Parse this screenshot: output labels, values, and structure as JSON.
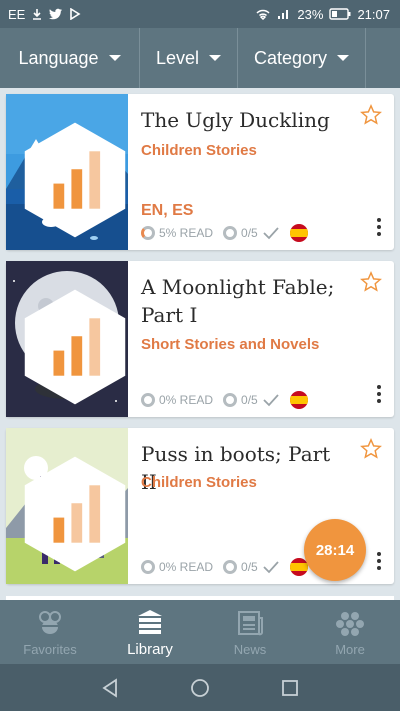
{
  "status_bar": {
    "carrier": "EE",
    "battery": "23%",
    "time": "21:07"
  },
  "filters": [
    {
      "label": "Language"
    },
    {
      "label": "Level"
    },
    {
      "label": "Category"
    }
  ],
  "books": [
    {
      "title": "The Ugly Duckling",
      "category": "Children Stories",
      "languages": "EN, ES",
      "read": "5% READ",
      "quiz": "0/5",
      "read_fraction": 0.05
    },
    {
      "title": "A Moonlight Fable; Part I",
      "category": "Short Stories and Novels",
      "languages": "",
      "read": "0% READ",
      "quiz": "0/5",
      "read_fraction": 0
    },
    {
      "title": "Puss in boots; Part II",
      "category": "Children Stories",
      "languages": "",
      "read": "0% READ",
      "quiz": "0/5",
      "read_fraction": 0
    }
  ],
  "timer": "28:14",
  "nav": [
    {
      "label": "Favorites",
      "icon": "bee-icon"
    },
    {
      "label": "Library",
      "icon": "library-icon"
    },
    {
      "label": "News",
      "icon": "news-icon"
    },
    {
      "label": "More",
      "icon": "honeycomb-icon"
    }
  ],
  "colors": {
    "accent": "#e07a45",
    "timer": "#f0953e",
    "bar": "#5e7580"
  }
}
